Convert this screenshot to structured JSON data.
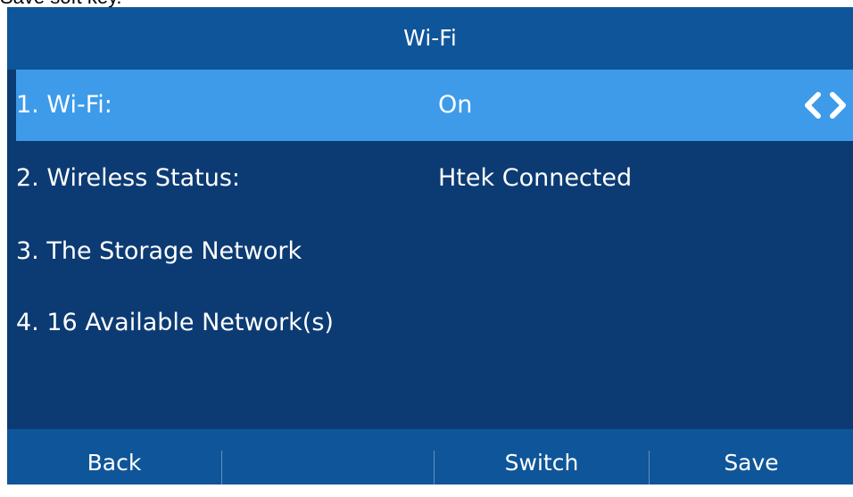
{
  "caption": "Save soft key.",
  "header": {
    "title": "Wi-Fi"
  },
  "menu": {
    "items": [
      {
        "label": "1. Wi-Fi:",
        "value": "On"
      },
      {
        "label": "2. Wireless Status:",
        "value": "Htek Connected"
      },
      {
        "label": "3. The Storage Network",
        "value": ""
      },
      {
        "label": "4. 16 Available Network(s)",
        "value": ""
      }
    ],
    "selected_index": 0
  },
  "softkeys": {
    "back": "Back",
    "empty1": "",
    "switch": "Switch",
    "save": "Save"
  },
  "colors": {
    "screen_background": "#0c3b73",
    "bar_background": "#0f5599",
    "selection": "#3d9be9",
    "text": "#ffffff"
  },
  "icons": {
    "selector": "chevron-left-right-icon"
  }
}
